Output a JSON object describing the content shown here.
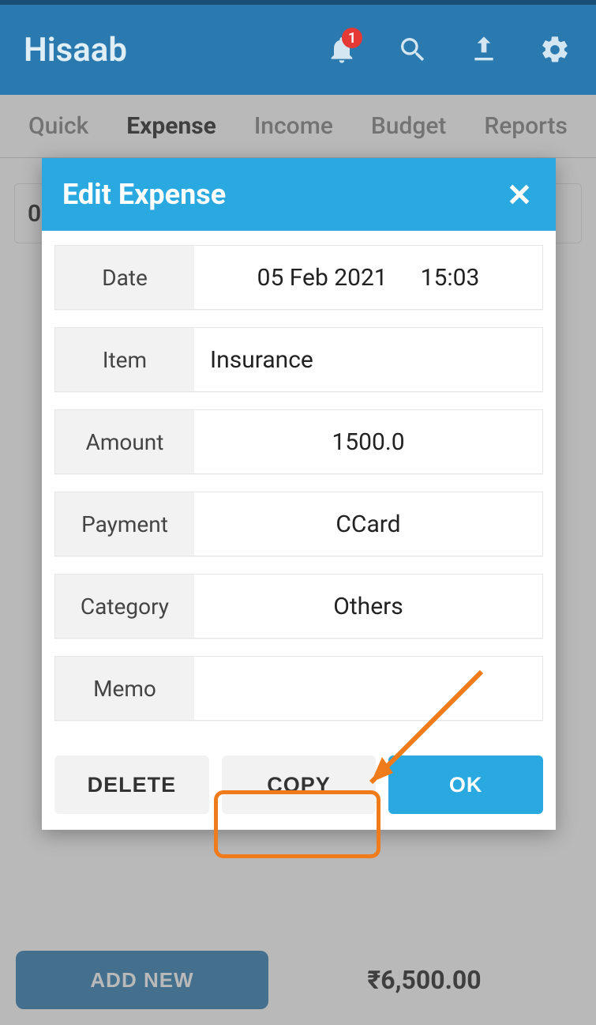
{
  "appbar": {
    "title": "Hisaab",
    "notification_badge": "1"
  },
  "tabs": [
    "Quick",
    "Expense",
    "Income",
    "Budget",
    "Reports"
  ],
  "active_tab_index": 1,
  "background": {
    "row_prefix": "0",
    "add_button": "ADD NEW",
    "total": "₹6,500.00"
  },
  "dialog": {
    "title": "Edit Expense",
    "fields": {
      "date_label": "Date",
      "date_value": "05 Feb 2021",
      "time_value": "15:03",
      "item_label": "Item",
      "item_value": "Insurance",
      "amount_label": "Amount",
      "amount_value": "1500.0",
      "payment_label": "Payment",
      "payment_value": "CCard",
      "category_label": "Category",
      "category_value": "Others",
      "memo_label": "Memo",
      "memo_value": ""
    },
    "buttons": {
      "delete": "DELETE",
      "copy": "COPY",
      "ok": "OK"
    }
  }
}
